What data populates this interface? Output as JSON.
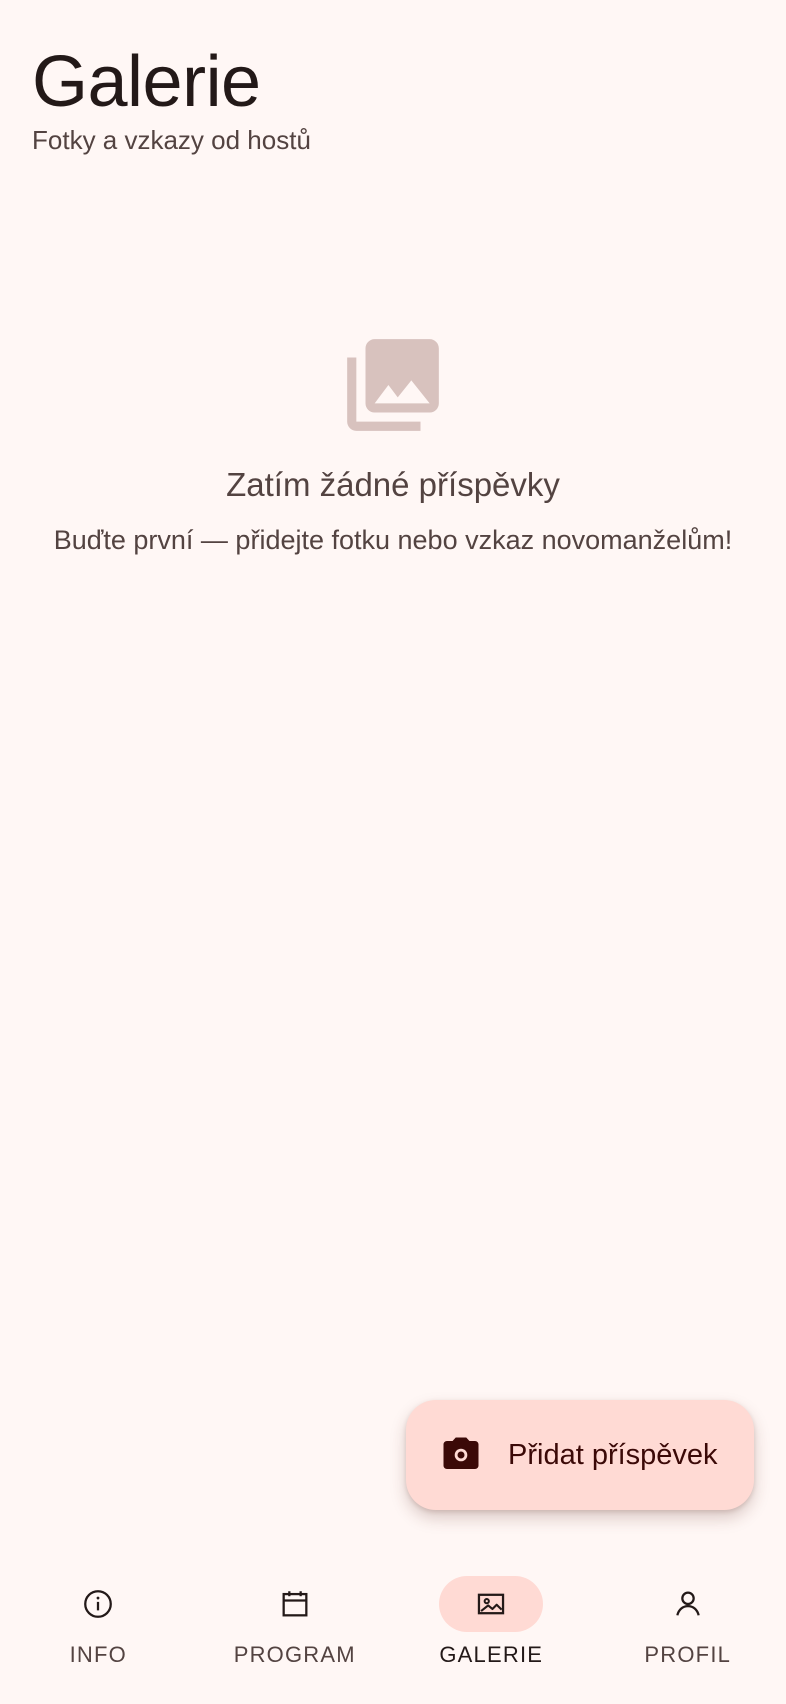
{
  "header": {
    "title": "Galerie",
    "subtitle": "Fotky a vzkazy od hostů"
  },
  "empty_state": {
    "icon": "photo-library-icon",
    "title": "Zatím žádné příspěvky",
    "message": "Buďte první — přidejte fotku nebo vzkaz novomanželům!"
  },
  "fab": {
    "icon": "camera-icon",
    "label": "Přidat příspěvek"
  },
  "bottom_nav": {
    "items": [
      {
        "label": "INFO",
        "icon": "info-icon",
        "active": false
      },
      {
        "label": "PROGRAM",
        "icon": "calendar-icon",
        "active": false
      },
      {
        "label": "GALERIE",
        "icon": "image-icon",
        "active": true
      },
      {
        "label": "PROFIL",
        "icon": "person-icon",
        "active": false
      }
    ]
  },
  "colors": {
    "background": "#FFF7F5",
    "primary_container": "#FFDAD4",
    "on_surface": "#231918",
    "on_surface_variant": "#534341",
    "empty_icon": "#D8C2BE"
  }
}
